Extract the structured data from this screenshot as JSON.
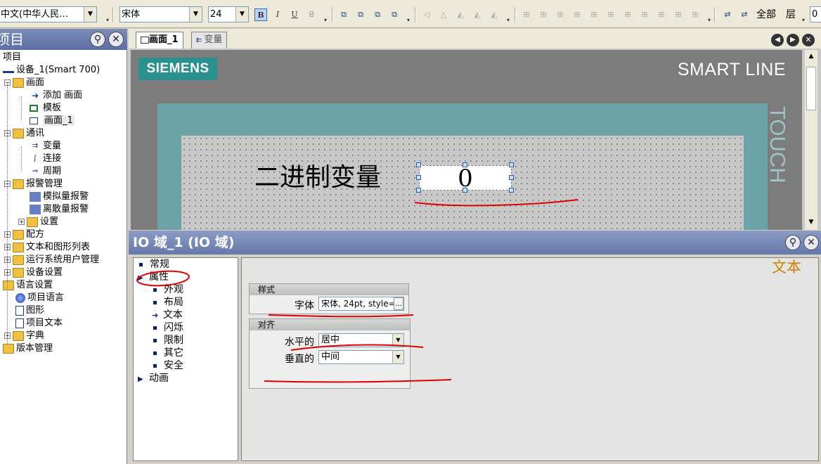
{
  "toolbar": {
    "language": "中文(中华人民…",
    "font": "宋体",
    "size": "24",
    "bold": "B",
    "italic": "I",
    "underline": "U",
    "all_label": "全部",
    "layer_label": "层",
    "layer_value": "0"
  },
  "project_panel": {
    "title": "项目",
    "items": [
      {
        "label": "项目"
      },
      {
        "label": "设备_1(Smart 700)"
      },
      {
        "label": "画面"
      },
      {
        "label": "添加 画面"
      },
      {
        "label": "模板"
      },
      {
        "label": "画面_1"
      },
      {
        "label": "通讯"
      },
      {
        "label": "变量"
      },
      {
        "label": "连接"
      },
      {
        "label": "周期"
      },
      {
        "label": "报警管理"
      },
      {
        "label": "模拟量报警"
      },
      {
        "label": "离散量报警"
      },
      {
        "label": "设置"
      },
      {
        "label": "配方"
      },
      {
        "label": "文本和图形列表"
      },
      {
        "label": "运行系统用户管理"
      },
      {
        "label": "设备设置"
      },
      {
        "label": "语言设置"
      },
      {
        "label": "项目语言"
      },
      {
        "label": "图形"
      },
      {
        "label": "项目文本"
      },
      {
        "label": "字典"
      },
      {
        "label": "版本管理"
      }
    ]
  },
  "editor": {
    "tabs": [
      {
        "label": "画面_1"
      },
      {
        "label": "变量"
      }
    ],
    "device": {
      "brand": "SIEMENS",
      "line": "SMART LINE",
      "side_label": "TOUCH"
    },
    "screen": {
      "text_label": "二进制变量",
      "io_value": "0"
    }
  },
  "properties": {
    "title": "IO 域_1 (IO 域)",
    "section_label": "文本",
    "nav": [
      {
        "label": "常规"
      },
      {
        "label": "属性"
      },
      {
        "label": "外观"
      },
      {
        "label": "布局"
      },
      {
        "label": "文本"
      },
      {
        "label": "闪烁"
      },
      {
        "label": "限制"
      },
      {
        "label": "其它"
      },
      {
        "label": "安全"
      },
      {
        "label": "动画"
      }
    ],
    "style_group": {
      "title": "样式",
      "font_label": "字体",
      "font_value": "宋体, 24pt, style=",
      "browse": "..."
    },
    "align_group": {
      "title": "对齐",
      "horizontal_label": "水平的",
      "horizontal_value": "居中",
      "vertical_label": "垂直的",
      "vertical_value": "中间"
    }
  },
  "colors": {
    "siemens_teal": "#2a9090",
    "screen_frame": "#6ba3a8",
    "annotation": "#e00000",
    "section_label": "#d08000"
  }
}
